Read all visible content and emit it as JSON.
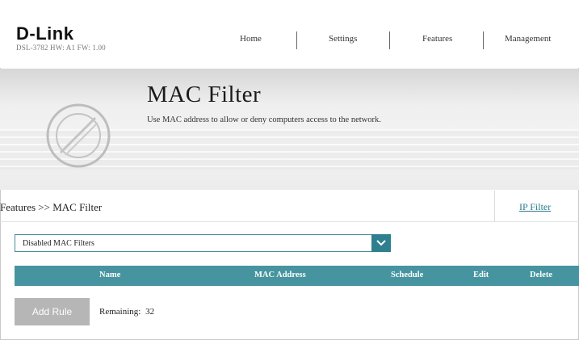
{
  "header": {
    "logo": "D-Link",
    "device_info": "DSL-3782  HW: A1  FW: 1.00",
    "nav": [
      "Home",
      "Settings",
      "Features",
      "Management"
    ]
  },
  "banner": {
    "title": "MAC Filter",
    "description": "Use MAC address to allow or deny computers access to the network.",
    "icon": "prohibited-icon"
  },
  "breadcrumb": {
    "path": "Features >> MAC Filter",
    "side_link": "IP Filter"
  },
  "filter_select": {
    "value": "Disabled MAC Filters",
    "icon": "chevron-down-icon"
  },
  "table": {
    "columns": [
      "Name",
      "MAC Address",
      "Schedule",
      "Edit",
      "Delete"
    ],
    "rows": []
  },
  "footer": {
    "add_rule_label": "Add Rule",
    "remaining_label": "Remaining:",
    "remaining_count": "32"
  },
  "colors": {
    "accent": "#46949f",
    "select_button": "#2f7f8e",
    "link": "#2b7b8c",
    "add_button": "#b6b6b6"
  }
}
